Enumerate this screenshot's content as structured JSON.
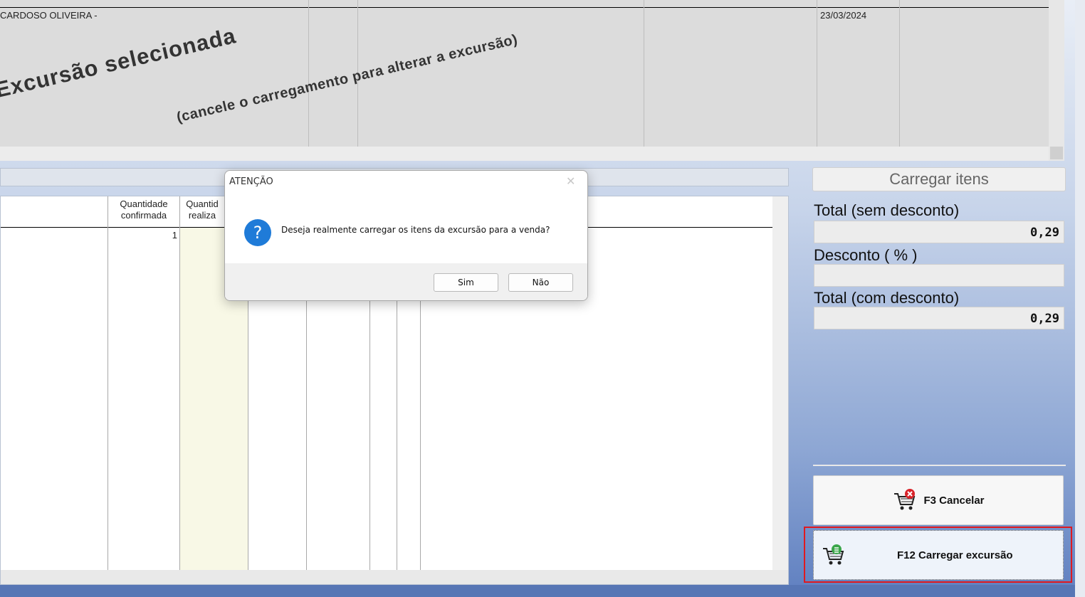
{
  "top_grid": {
    "row1": {
      "name": "CARDOSO OLIVEIRA -",
      "date": "23/03/2024"
    },
    "watermark_title": "Excursão selecionada",
    "watermark_subtitle": "(cancele o carregamento para alterar a excursão)"
  },
  "bottom_grid": {
    "headers": {
      "qty_confirmed": "Quantidade\nconfirmada",
      "qty_done": "Quantid\nrealiza"
    },
    "rows": [
      {
        "qty_confirmed": "1"
      }
    ]
  },
  "right_panel": {
    "load_items_label": "Carregar itens",
    "total_sem_label": "Total (sem desconto)",
    "total_sem_value": "0,29",
    "desconto_label": "Desconto ( % )",
    "desconto_value": "",
    "total_com_label": "Total (com desconto)",
    "total_com_value": "0,29",
    "cancel_button": "F3  Cancelar",
    "load_button": "F12 Carregar excursão"
  },
  "dialog": {
    "title": "ATENÇÃO",
    "message": "Deseja realmente carregar os itens da excursão para a venda?",
    "yes": "Sim",
    "no": "Não"
  },
  "colors": {
    "highlight_frame": "#e0191f",
    "question_icon": "#1f7bd8"
  }
}
